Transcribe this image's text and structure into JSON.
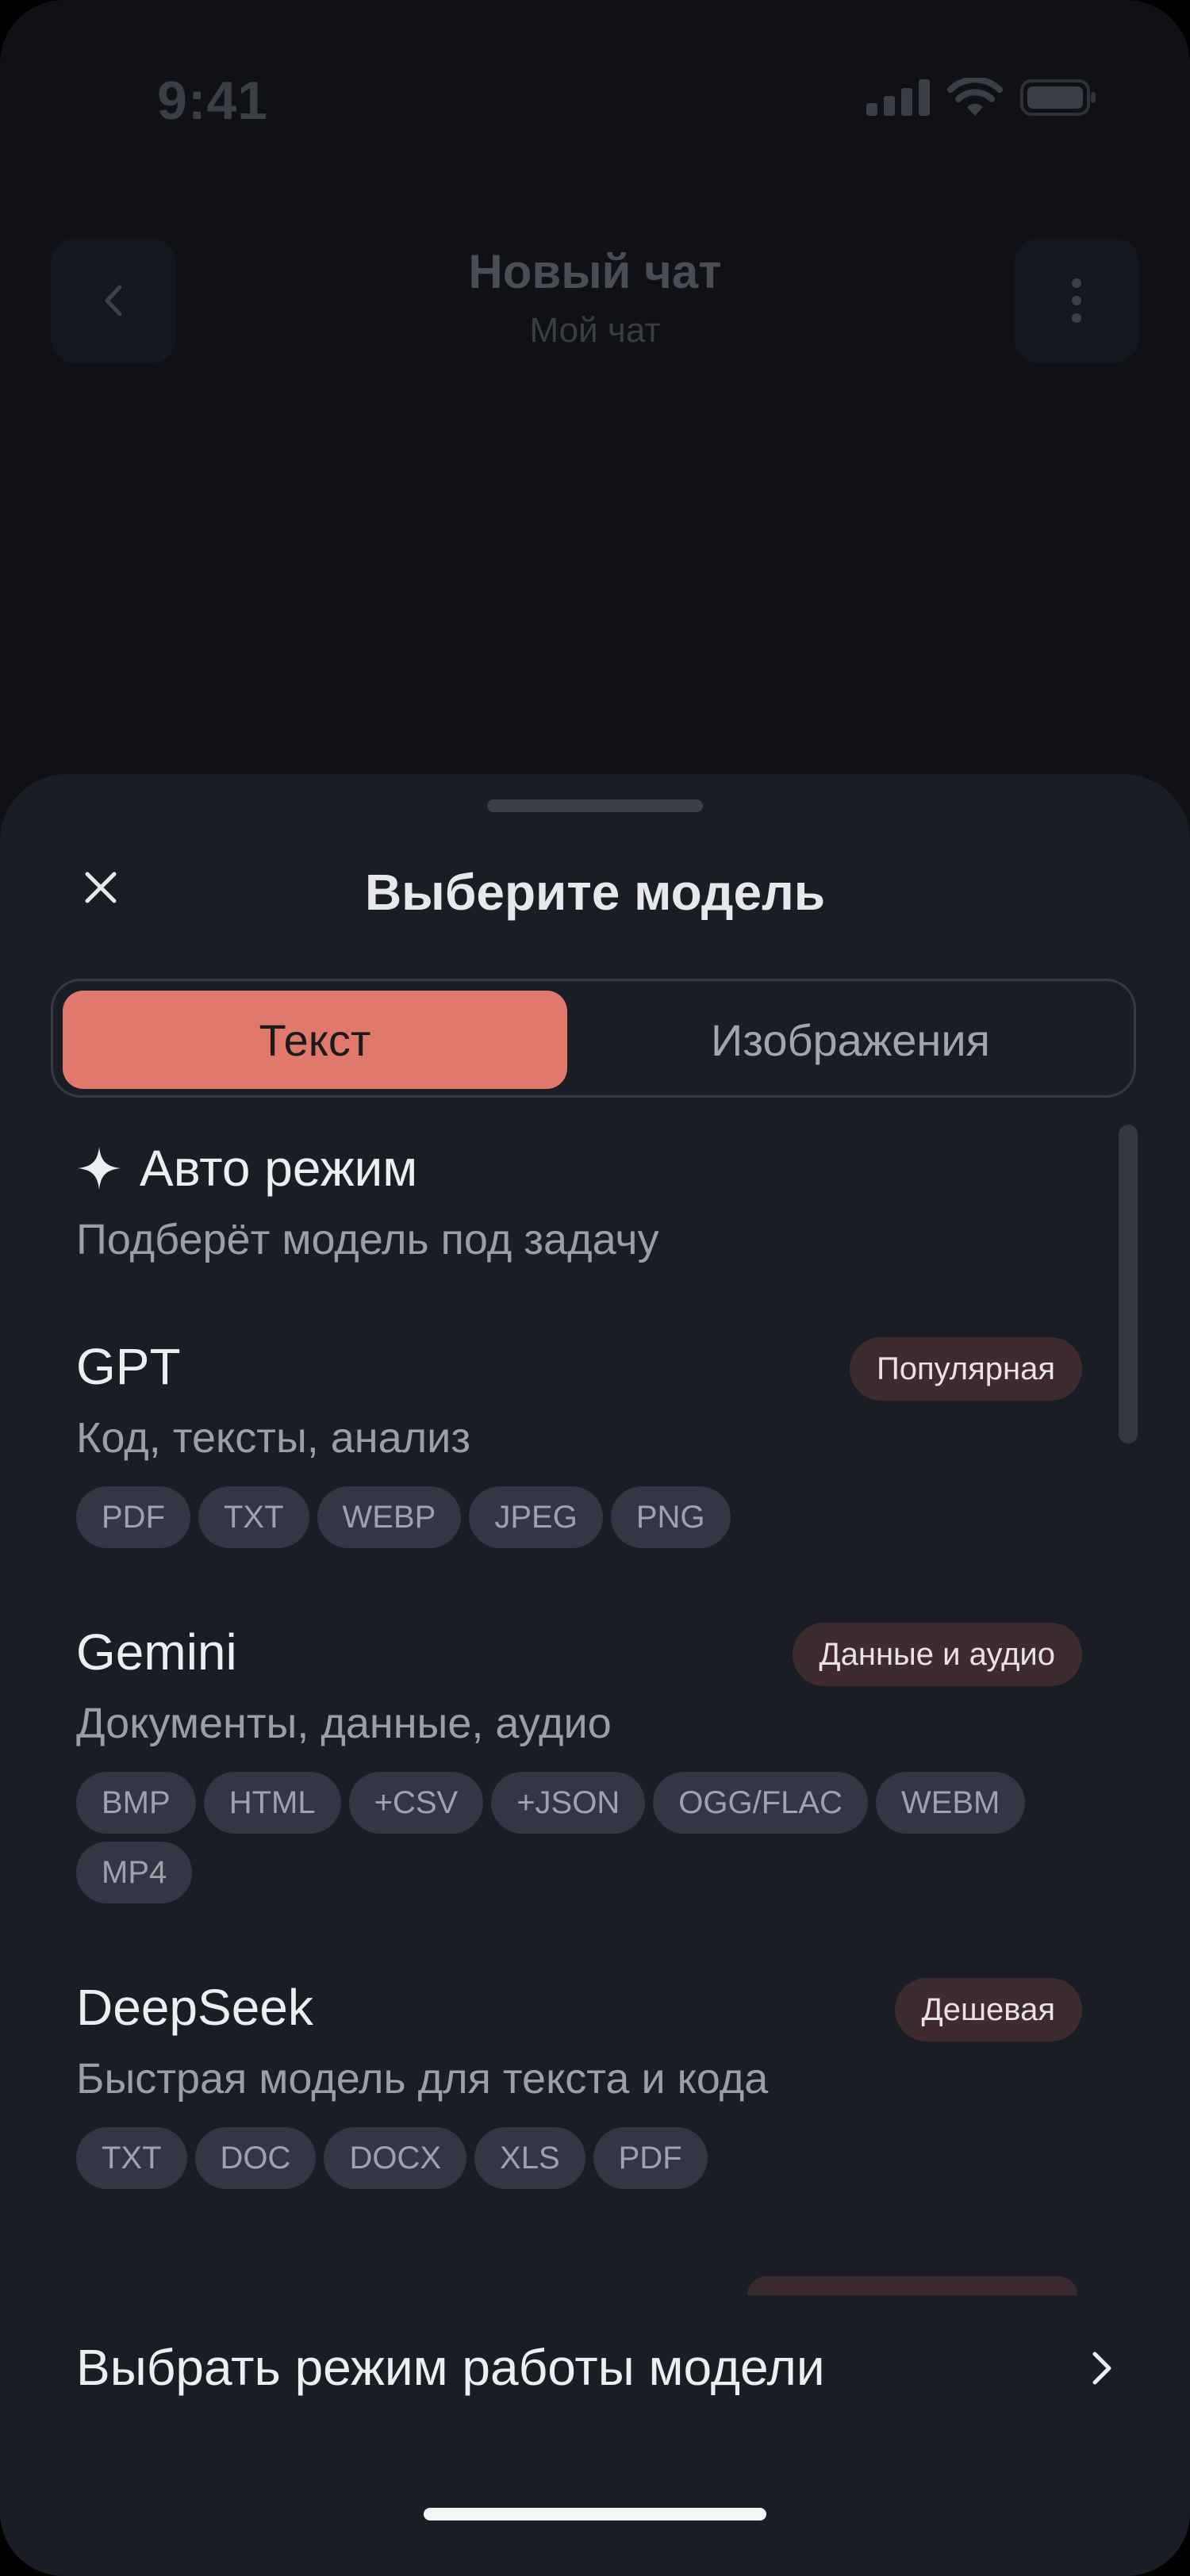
{
  "status": {
    "time": "9:41"
  },
  "chat": {
    "title": "Новый чат",
    "subtitle": "Мой чат"
  },
  "sheet": {
    "title": "Выберите модель",
    "tabs": [
      {
        "label": "Текст",
        "active": true
      },
      {
        "label": "Изображения",
        "active": false
      }
    ],
    "auto": {
      "title": "Авто режим",
      "description": "Подберёт модель под задачу"
    },
    "models": [
      {
        "name": "GPT",
        "badge": "Популярная",
        "description": "Код, тексты, анализ",
        "formats": [
          "PDF",
          "TXT",
          "WEBP",
          "JPEG",
          "PNG"
        ]
      },
      {
        "name": "Gemini",
        "badge": "Данные и аудио",
        "description": "Документы, данные, аудио",
        "formats": [
          "BMP",
          "HTML",
          "+CSV",
          "+JSON",
          "OGG/FLAC",
          "WEBM",
          "MP4"
        ]
      },
      {
        "name": "DeepSeek",
        "badge": "Дешевая",
        "description": "Быстрая модель для текста и кода",
        "formats": [
          "TXT",
          "DOC",
          "DOCX",
          "XLS",
          "PDF"
        ]
      }
    ],
    "mode_link": "Выбрать режим работы модели"
  },
  "colors": {
    "accent": "#e0796b",
    "sheet_bg": "#1a1d25",
    "badge_bg": "#3d2b30",
    "chip_bg": "#333744"
  }
}
